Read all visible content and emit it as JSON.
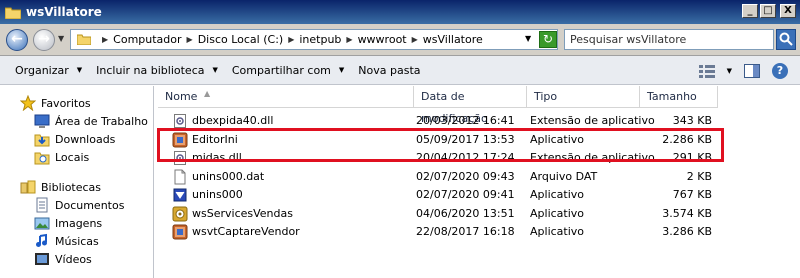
{
  "window": {
    "title": "wsVillatore",
    "min": "_",
    "max": "□",
    "close": "X"
  },
  "address": {
    "crumbs": [
      "Computador",
      "Disco Local (C:)",
      "inetpub",
      "wwwroot",
      "wsVillatore"
    ],
    "search_placeholder": "Pesquisar wsVillatore"
  },
  "toolbar": {
    "organize": "Organizar",
    "include": "Incluir na biblioteca",
    "share": "Compartilhar com",
    "new_folder": "Nova pasta",
    "help": "?"
  },
  "sidebar": {
    "favorites": {
      "label": "Favoritos",
      "items": [
        "Área de Trabalho",
        "Downloads",
        "Locais"
      ]
    },
    "libraries": {
      "label": "Bibliotecas",
      "items": [
        "Documentos",
        "Imagens",
        "Músicas",
        "Vídeos"
      ]
    }
  },
  "columns": [
    "Nome",
    "Data de modificação",
    "Tipo",
    "Tamanho"
  ],
  "files": [
    {
      "name": "dbexpida40.dll",
      "date": "20/03/2012 16:41",
      "type": "Extensão de aplicativo",
      "size": "343 KB",
      "icon": "dll-icon"
    },
    {
      "name": "EditorIni",
      "date": "05/09/2017 13:53",
      "type": "Aplicativo",
      "size": "2.286 KB",
      "icon": "app-icon"
    },
    {
      "name": "midas.dll",
      "date": "20/04/2012 17:24",
      "type": "Extensão de aplicativo",
      "size": "291 KB",
      "icon": "dll-icon"
    },
    {
      "name": "unins000.dat",
      "date": "02/07/2020 09:43",
      "type": "Arquivo DAT",
      "size": "2 KB",
      "icon": "file-icon"
    },
    {
      "name": "unins000",
      "date": "02/07/2020 09:41",
      "type": "Aplicativo",
      "size": "767 KB",
      "icon": "installer-icon"
    },
    {
      "name": "wsServicesVendas",
      "date": "04/06/2020 13:51",
      "type": "Aplicativo",
      "size": "3.574 KB",
      "icon": "service-icon"
    },
    {
      "name": "wsvtCaptareVendor",
      "date": "22/08/2017 16:18",
      "type": "Aplicativo",
      "size": "3.286 KB",
      "icon": "app-icon"
    }
  ],
  "colors": {
    "highlight": "#e01020",
    "title_bar": "#0a246a"
  }
}
